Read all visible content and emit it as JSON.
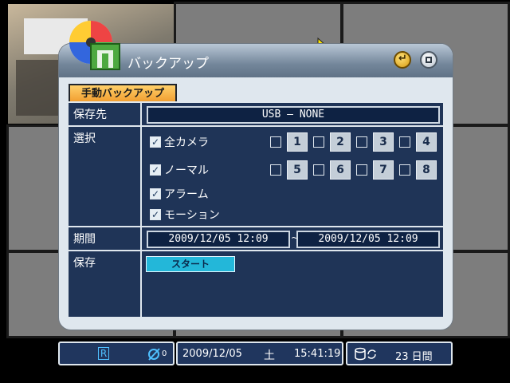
{
  "window": {
    "title": "バックアップ",
    "icon": "backup-cd-icon",
    "back_icon": "back-icon",
    "close_icon": "close-icon"
  },
  "tab": {
    "label": "手動バックアップ"
  },
  "rows": {
    "destination": {
      "label": "保存先",
      "value": "USB – NONE"
    },
    "select": {
      "label": "選択",
      "all_camera": {
        "label": "全カメラ",
        "checked": true
      },
      "normal": {
        "label": "ノーマル",
        "checked": true
      },
      "alarm": {
        "label": "アラーム",
        "checked": true
      },
      "motion": {
        "label": "モーション",
        "checked": true
      },
      "cameras": [
        "1",
        "2",
        "3",
        "4",
        "5",
        "6",
        "7",
        "8"
      ],
      "checkmark": "✓"
    },
    "period": {
      "label": "期間",
      "start": "2009/12/05  12:09",
      "separator": "~",
      "end": "2009/12/05  12:09"
    },
    "save": {
      "label": "保存",
      "button": "スタート"
    }
  },
  "statusbar": {
    "record_badge": "R",
    "net_badge": "0",
    "date": "2009/12/05",
    "weekday": "土",
    "time": "15:41:19",
    "days": "23 日間"
  }
}
